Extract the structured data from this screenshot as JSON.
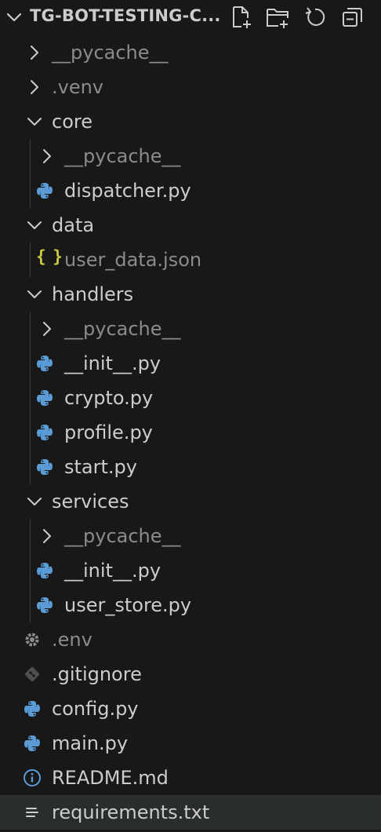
{
  "explorer": {
    "title": "TG-BOT-TESTING-C...",
    "actions": [
      {
        "name": "new-file",
        "icon": "new-file-icon"
      },
      {
        "name": "new-folder",
        "icon": "new-folder-icon"
      },
      {
        "name": "refresh",
        "icon": "refresh-icon"
      },
      {
        "name": "collapse-all",
        "icon": "collapse-all-icon"
      }
    ]
  },
  "tree": [
    {
      "label": "__pycache__",
      "type": "folder",
      "expanded": false,
      "muted": true
    },
    {
      "label": ".venv",
      "type": "folder",
      "expanded": false,
      "muted": true
    },
    {
      "label": "core",
      "type": "folder",
      "expanded": true
    },
    {
      "label": "__pycache__",
      "type": "folder",
      "expanded": false,
      "muted": true
    },
    {
      "label": "dispatcher.py",
      "type": "python"
    },
    {
      "label": "data",
      "type": "folder",
      "expanded": true
    },
    {
      "label": "user_data.json",
      "type": "json",
      "muted": true
    },
    {
      "label": "handlers",
      "type": "folder",
      "expanded": true
    },
    {
      "label": "__pycache__",
      "type": "folder",
      "expanded": false,
      "muted": true
    },
    {
      "label": "__init__.py",
      "type": "python"
    },
    {
      "label": "crypto.py",
      "type": "python"
    },
    {
      "label": "profile.py",
      "type": "python"
    },
    {
      "label": "start.py",
      "type": "python"
    },
    {
      "label": "services",
      "type": "folder",
      "expanded": true
    },
    {
      "label": "__pycache__",
      "type": "folder",
      "expanded": false,
      "muted": true
    },
    {
      "label": "__init__.py",
      "type": "python"
    },
    {
      "label": "user_store.py",
      "type": "python"
    },
    {
      "label": ".env",
      "type": "env",
      "muted": true
    },
    {
      "label": ".gitignore",
      "type": "git"
    },
    {
      "label": "config.py",
      "type": "python"
    },
    {
      "label": "main.py",
      "type": "python"
    },
    {
      "label": "README.md",
      "type": "info"
    },
    {
      "label": "requirements.txt",
      "type": "text",
      "selected": true
    }
  ],
  "colors": {
    "background": "#181818",
    "text": "#cccccc",
    "muted_text": "#8b8b8b",
    "python_icon": "#5b9bd5",
    "json_icon": "#cbcb41",
    "selection": "#2a2d2e"
  }
}
